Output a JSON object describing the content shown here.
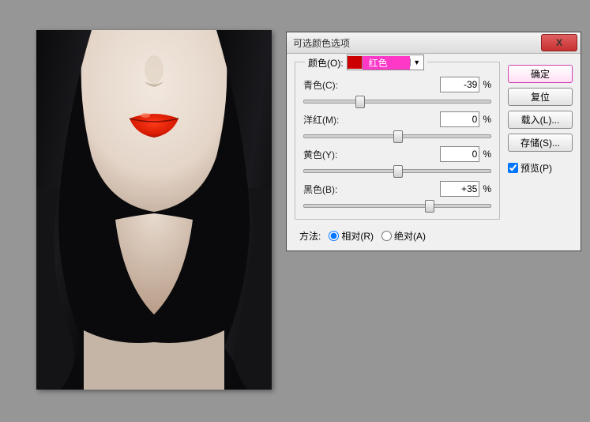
{
  "dialog": {
    "title": "可选颜色选项",
    "color_label": "颜色(O):",
    "color_name": "红色",
    "sliders": [
      {
        "name": "青色(C):",
        "value": "-39",
        "unit": "%",
        "pos": 30
      },
      {
        "name": "洋红(M):",
        "value": "0",
        "unit": "%",
        "pos": 50
      },
      {
        "name": "黄色(Y):",
        "value": "0",
        "unit": "%",
        "pos": 50
      },
      {
        "name": "黑色(B):",
        "value": "+35",
        "unit": "%",
        "pos": 67
      }
    ],
    "method_label": "方法:",
    "method_relative": "相对(R)",
    "method_absolute": "绝对(A)",
    "ok": "确定",
    "reset": "复位",
    "load": "载入(L)...",
    "save": "存储(S)...",
    "preview": "预览(P)"
  }
}
